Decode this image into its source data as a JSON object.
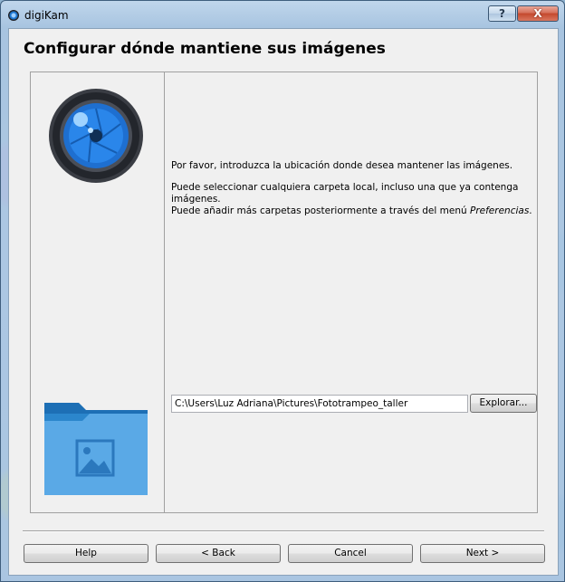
{
  "window": {
    "title": "digiKam",
    "help_glyph": "?",
    "close_glyph": "X"
  },
  "page": {
    "title": "Configurar dónde mantiene sus imágenes"
  },
  "content": {
    "intro": "Por favor, introduzca la ubicación donde desea mantener las imágenes.",
    "detail_line1": "Puede seleccionar cualquiera carpeta local, incluso una que ya contenga imágenes.",
    "detail_line2_prefix": "Puede añadir más carpetas posteriormente a través del menú ",
    "detail_line2_menu": "Preferencias",
    "detail_line2_suffix": "."
  },
  "path_field": {
    "value": "C:\\Users\\Luz Adriana\\Pictures\\Fototrampeo_taller"
  },
  "buttons": {
    "browse": "Explorar...",
    "help": "Help",
    "back": "< Back",
    "cancel": "Cancel",
    "next": "Next >"
  },
  "icons": {
    "app": "digikam-app-icon",
    "lens": "camera-lens-icon",
    "folder": "pictures-folder-icon"
  }
}
